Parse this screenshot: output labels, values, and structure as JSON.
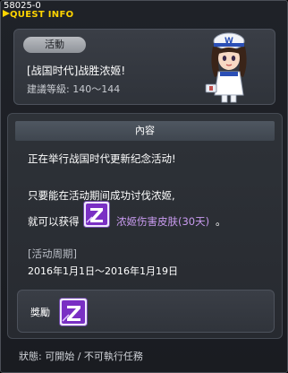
{
  "window": {
    "quest_id": "58025-0",
    "title": "QUEST INFO"
  },
  "header": {
    "badge": "活動",
    "quest_name": "[战国时代]战胜浓姬!",
    "level_requirement": "建議等級: 140～144"
  },
  "content": {
    "section_title": "內容",
    "line1": "正在举行战国时代更新纪念活动!",
    "line2": "只要能在活动期间成功讨伐浓姬,",
    "line3_prefix": "就可以获得",
    "reward_name": "浓姬伤害皮肤(30天)",
    "line3_suffix": "。",
    "period_label": "[活动周期]",
    "period_dates": "2016年1月1日～2016年1月19日"
  },
  "reward": {
    "label": "獎勵",
    "icon": "purple-z-skin-icon"
  },
  "status": {
    "text": "狀態: 可開始 / 不可執行任務"
  },
  "colors": {
    "title_yellow": "#ffd400",
    "reward_purple": "#c99bf0",
    "icon_purple": "#7a2fc4"
  }
}
